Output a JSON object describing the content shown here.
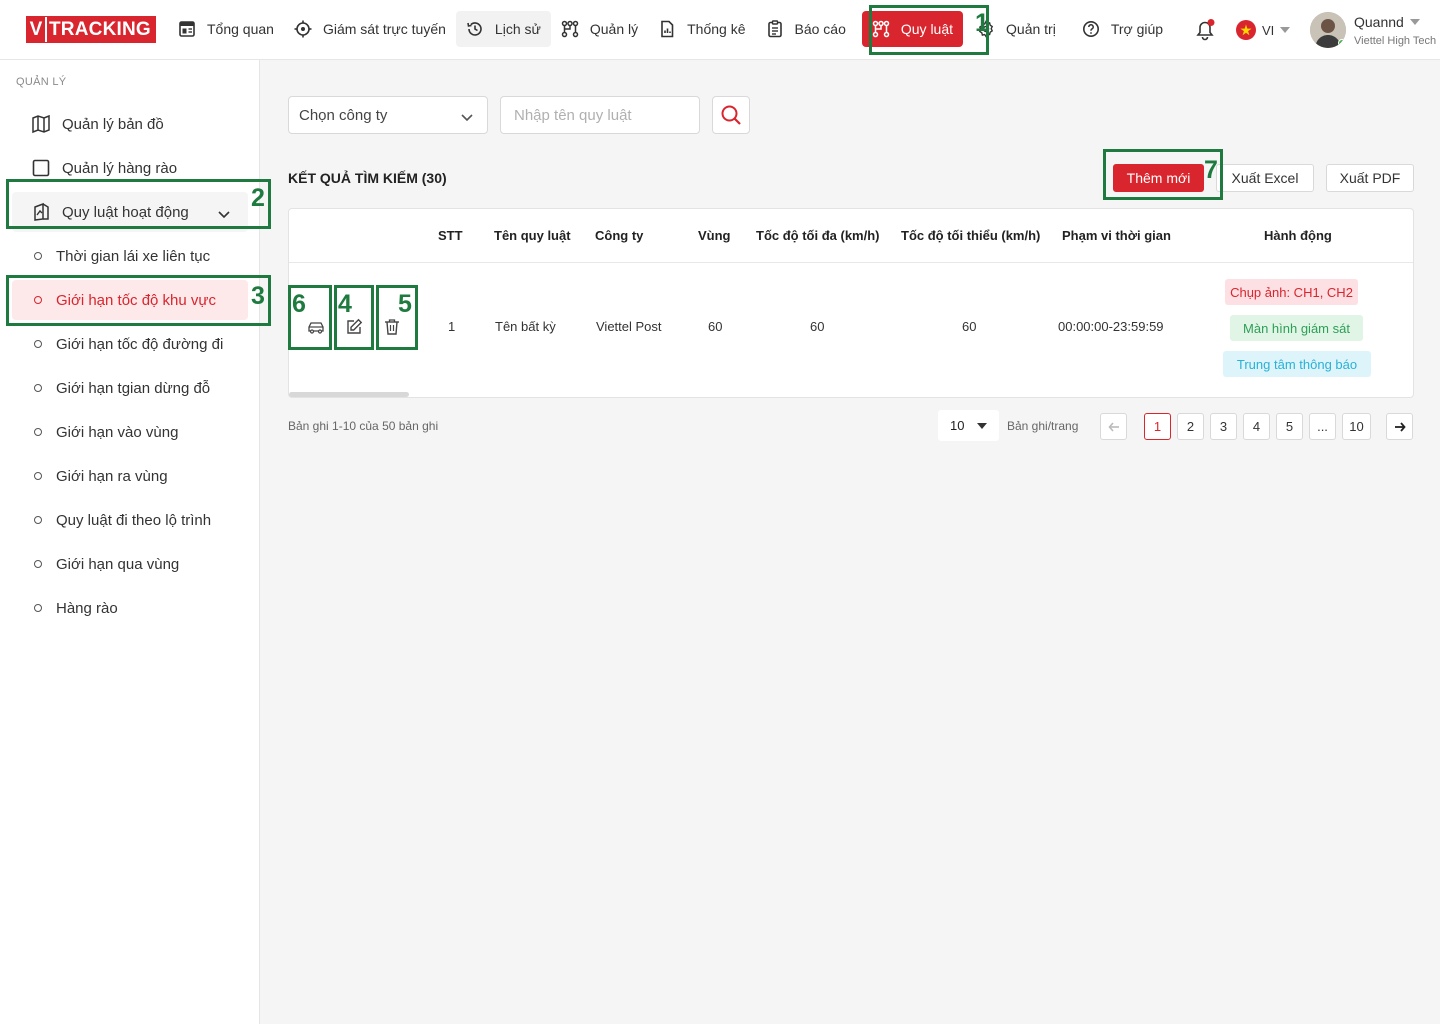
{
  "brand": {
    "logo_v": "V",
    "logo_text": "TRACKING"
  },
  "nav": {
    "items": [
      {
        "label": "Tổng quan",
        "icon": "dashboard-icon"
      },
      {
        "label": "Giám sát trực tuyến",
        "icon": "crosshair-icon"
      },
      {
        "label": "Lịch sử",
        "icon": "history-icon"
      },
      {
        "label": "Quản lý",
        "icon": "nodes-icon"
      },
      {
        "label": "Thống kê",
        "icon": "file-chart-icon"
      },
      {
        "label": "Báo cáo",
        "icon": "clipboard-icon"
      },
      {
        "label": "Quy luật",
        "icon": "rules-icon"
      },
      {
        "label": "Quản trị",
        "icon": "gear-icon"
      },
      {
        "label": "Trợ giúp",
        "icon": "help-icon"
      }
    ],
    "active": "Quy luật"
  },
  "language": {
    "code": "VI"
  },
  "user": {
    "name": "Quannd",
    "org": "Viettel High Tech"
  },
  "sidebar": {
    "section": "QUẢN LÝ",
    "items": [
      {
        "label": "Quản lý bản đồ"
      },
      {
        "label": "Quản lý hàng rào"
      },
      {
        "label": "Quy luật hoạt động"
      }
    ],
    "sub_items": [
      {
        "label": "Thời gian lái xe liên tục"
      },
      {
        "label": "Giới hạn tốc độ khu vực"
      },
      {
        "label": "Giới hạn tốc độ đường đi"
      },
      {
        "label": "Giới hạn tgian dừng đỗ"
      },
      {
        "label": "Giới hạn vào vùng"
      },
      {
        "label": "Giới hạn ra vùng"
      },
      {
        "label": "Quy luật đi theo lộ trình"
      },
      {
        "label": "Giới hạn qua vùng"
      },
      {
        "label": "Hàng rào"
      }
    ]
  },
  "filters": {
    "company_select": "Chọn công ty",
    "rule_name_placeholder": "Nhập tên quy luật"
  },
  "results": {
    "title": "KẾT QUẢ TÌM KIẾM (30)",
    "add_label": "Thêm mới",
    "export_excel_label": "Xuất Excel",
    "export_pdf_label": "Xuất PDF"
  },
  "table": {
    "headers": [
      "STT",
      "Tên quy luật",
      "Công ty",
      "Vùng",
      "Tốc độ tối đa (km/h)",
      "Tốc độ tối thiểu (km/h)",
      "Phạm vi thời gian",
      "Hành động"
    ],
    "rows": [
      {
        "stt": "1",
        "name": "Tên bất kỳ",
        "company": "Viettel Post",
        "zone": "60",
        "max_speed": "60",
        "min_speed": "60",
        "time_range": "00:00:00-23:59:59",
        "actions": [
          "Chụp ảnh: CH1, CH2",
          "Màn hình giám sát",
          "Trung tâm thông báo"
        ]
      }
    ]
  },
  "pagination": {
    "info": "Bản ghi 1-10 của 50 bản ghi",
    "page_size": "10",
    "per_page_label": "Bản ghi/trang",
    "pages": [
      "1",
      "2",
      "3",
      "4",
      "5",
      "...",
      "10"
    ],
    "current": "1"
  },
  "annotations": [
    "1",
    "2",
    "3",
    "4",
    "5",
    "6",
    "7"
  ],
  "colors": {
    "brand_red": "#d9262e",
    "annotation_green": "#1e7a3e",
    "tag_green": "#2e9e57",
    "tag_cyan": "#2ab1d6"
  }
}
